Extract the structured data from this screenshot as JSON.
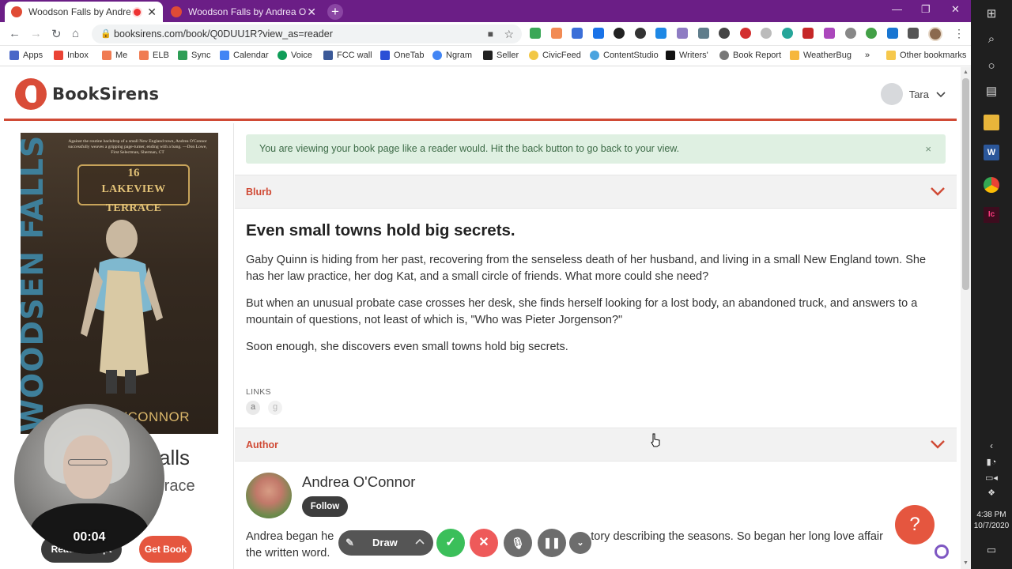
{
  "browser": {
    "tabs": [
      {
        "title": "Woodson Falls by Andrea O'Connor",
        "active": true
      },
      {
        "title": "Woodson Falls by Andrea O'Connor",
        "active": false
      }
    ],
    "url": "booksirens.com/book/Q0DUU1R?view_as=reader",
    "bookmarks": [
      "Apps",
      "Inbox",
      "Me",
      "ELB",
      "Sync",
      "Calendar",
      "Voice",
      "FCC wall",
      "OneTab",
      "Ngram",
      "Seller",
      "CivicFeed",
      "ContentStudio",
      "Writers'",
      "Book Report",
      "WeatherBug",
      "»",
      "Other bookmarks"
    ]
  },
  "site": {
    "brand": "BookSirens",
    "user": "Tara"
  },
  "book": {
    "cover": {
      "spine_text": "WOODSEN FALLS",
      "quote": "Against the routine backdrop of a small New England town, Andrea O'Connor successfully weaves a gripping page-turner, ending with a bang. —Don Lowe, First Selectman, Sherman, CT",
      "sign_number": "16",
      "sign_street": "LAKEVIEW TERRACE",
      "author": "O'CONNOR"
    },
    "title_partial": "alls",
    "subtitle_partial": "rrace",
    "read_excerpt_label": "Read Excerpt",
    "get_book_label": "Get Book"
  },
  "notice": {
    "text": "You are viewing your book page like a reader would. Hit the back button to go back to your view.",
    "close": "×"
  },
  "blurb": {
    "section_label": "Blurb",
    "title": "Even small towns hold big secrets.",
    "paragraphs": [
      "Gaby Quinn is hiding from her past, recovering from the senseless death of her husband, and living in a small New England town. She has her law practice, her dog Kat, and a small circle of friends. What more could she need?",
      "But when an unusual probate case crosses her desk, she finds herself looking for a lost body, an abandoned truck, and answers to a mountain of questions, not least of which is, \"Who was Pieter Jorgenson?\"",
      "Soon enough, she discovers even small towns hold big secrets."
    ],
    "links_label": "LINKS",
    "link_icons": [
      "a",
      "g"
    ]
  },
  "author": {
    "section_label": "Author",
    "name": "Andrea O'Connor",
    "follow_label": "Follow",
    "bio_line1_start": "Andrea began he",
    "bio_line1_end": "tory describing the seasons. So began her long love affair",
    "bio_line2": "the written word."
  },
  "recorder": {
    "timer": "00:04",
    "draw_label": "Draw"
  },
  "help_fab": "?",
  "taskbar": {
    "time": "4:38 PM",
    "date": "10/7/2020"
  }
}
